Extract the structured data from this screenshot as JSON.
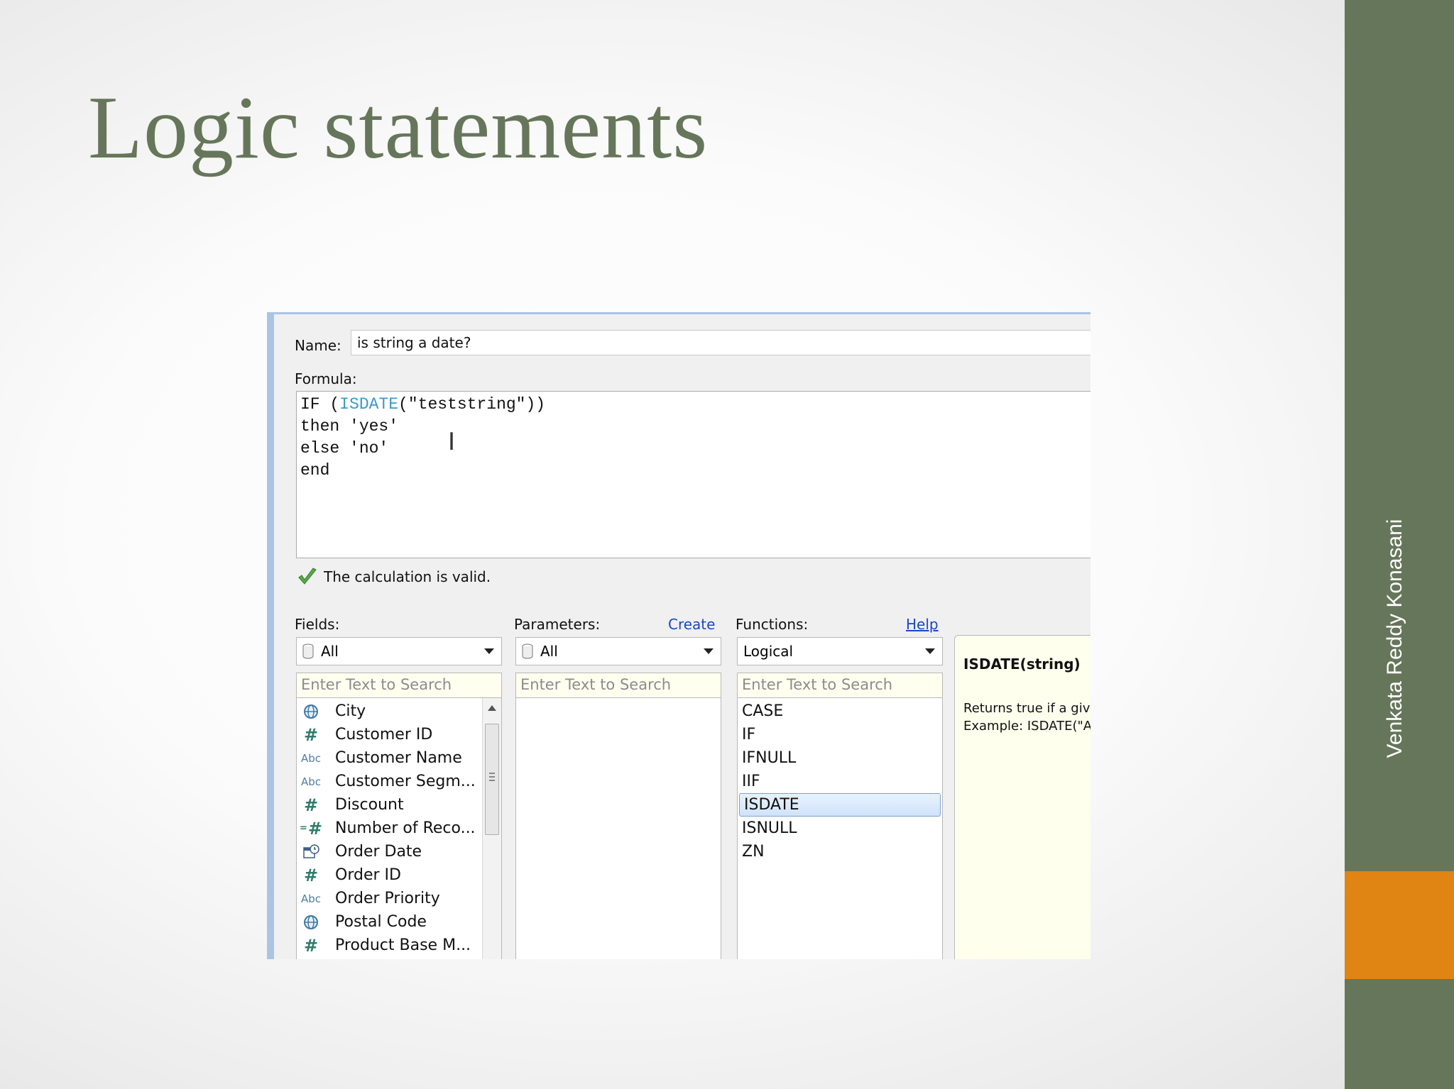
{
  "slide": {
    "title": "Logic statements",
    "author": "Venkata Reddy Konasani"
  },
  "colors": {
    "title": "#66765a",
    "band": "#66765a",
    "accent": "#e08414",
    "link": "#1a47c8",
    "formula_function": "#3a9ac9"
  },
  "dialog": {
    "name_label": "Name:",
    "name_value": "is string a date?",
    "formula_label": "Formula:",
    "formula": {
      "line1_pre": "IF (",
      "line1_fn": "ISDATE",
      "line1_post": "(\"teststring\"))",
      "line2": "then 'yes'",
      "line3": "else 'no'",
      "line4": "end"
    },
    "validation": {
      "icon": "check-icon",
      "text": "The calculation is valid."
    },
    "fields": {
      "label": "Fields:",
      "dropdown": "All",
      "search_placeholder": "Enter Text to Search",
      "items": [
        {
          "icon": "globe-icon",
          "name": "City"
        },
        {
          "icon": "hash-icon",
          "name": "Customer ID"
        },
        {
          "icon": "abc-icon",
          "name": "Customer Name"
        },
        {
          "icon": "abc-icon",
          "name": "Customer Segm..."
        },
        {
          "icon": "hash-icon",
          "name": "Discount"
        },
        {
          "icon": "calc-hash-icon",
          "name": "Number of Reco..."
        },
        {
          "icon": "calendar-icon",
          "name": "Order Date"
        },
        {
          "icon": "hash-icon",
          "name": "Order ID"
        },
        {
          "icon": "abc-icon",
          "name": "Order Priority"
        },
        {
          "icon": "globe-icon",
          "name": "Postal Code"
        },
        {
          "icon": "hash-icon",
          "name": "Product Base M..."
        }
      ]
    },
    "parameters": {
      "label": "Parameters:",
      "create_link": "Create",
      "dropdown": "All",
      "search_placeholder": "Enter Text to Search"
    },
    "functions": {
      "label": "Functions:",
      "help_link": "Help",
      "dropdown": "Logical",
      "search_placeholder": "Enter Text to Search",
      "items": [
        "CASE",
        "IF",
        "IFNULL",
        "IIF",
        "ISDATE",
        "ISNULL",
        "ZN"
      ],
      "selected": "ISDATE"
    },
    "help": {
      "signature": "ISDATE(string)",
      "desc_line1": "Returns true if a giv",
      "desc_line2": "Example: ISDATE(\"A"
    }
  }
}
